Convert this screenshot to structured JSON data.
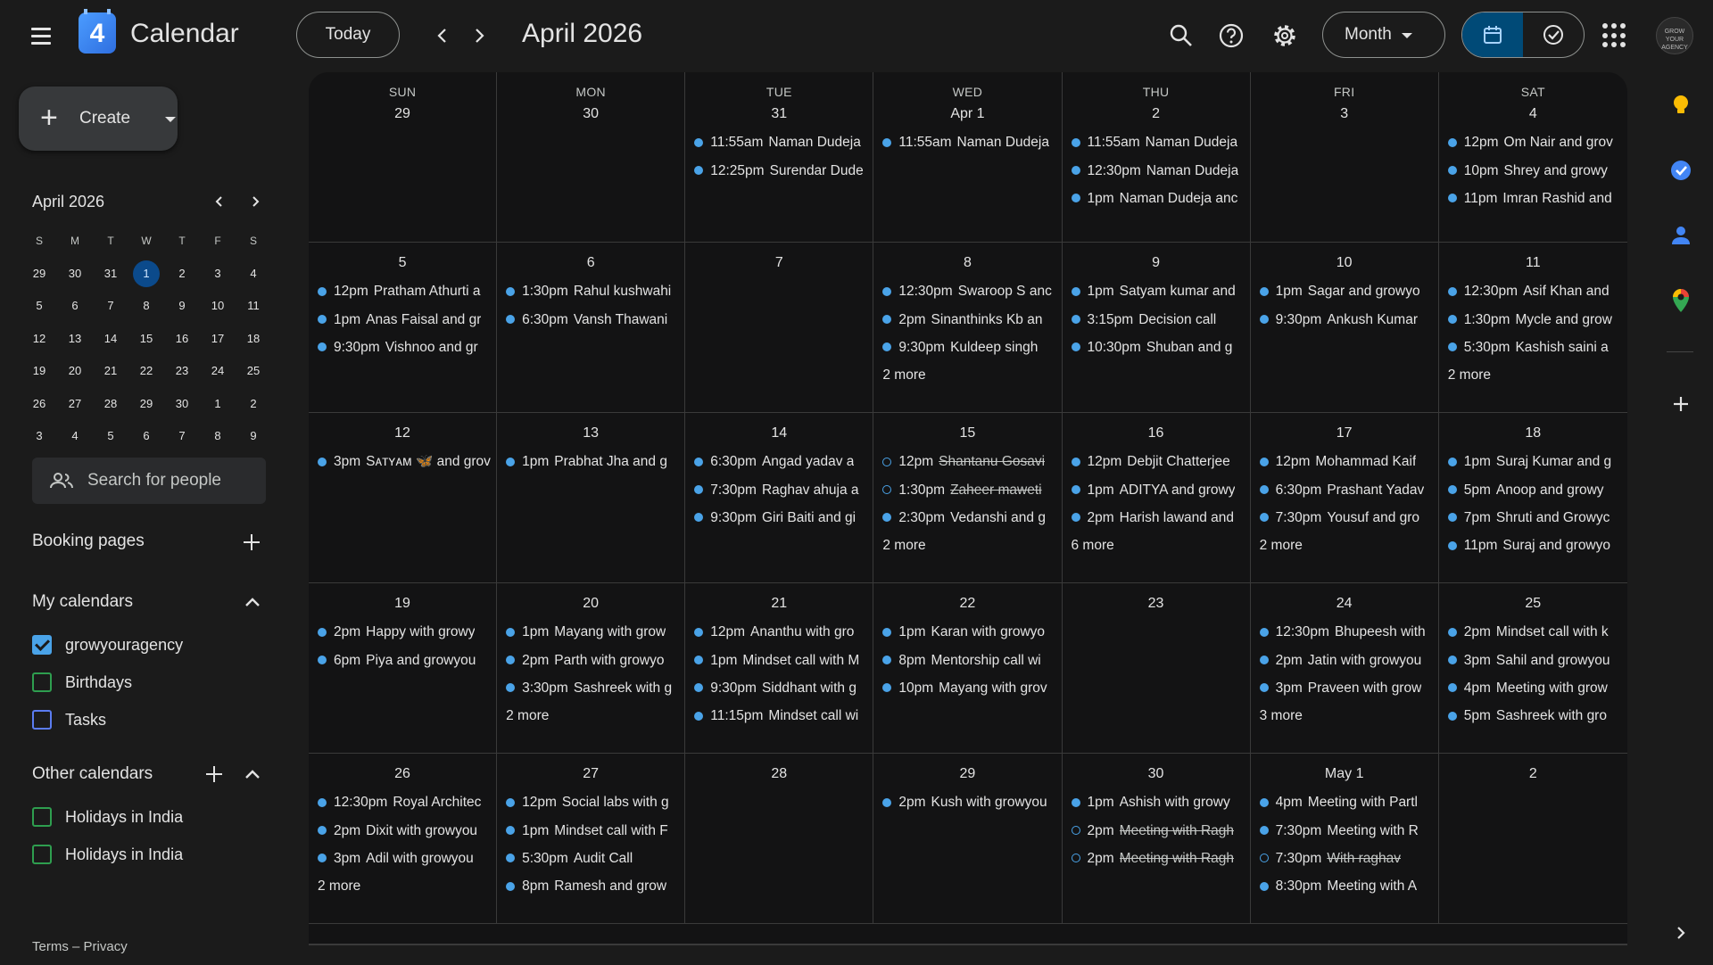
{
  "header": {
    "app_title": "Calendar",
    "logo_number": "4",
    "today_label": "Today",
    "period_title": "April 2026",
    "view_label": "Month",
    "prev_icon": "chevron-left-icon",
    "next_icon": "chevron-right-icon",
    "avatar_text": "GROW YOUR AGENCY"
  },
  "sidebar": {
    "create_label": "Create",
    "mini_calendar": {
      "title": "April 2026",
      "weekdays": [
        "S",
        "M",
        "T",
        "W",
        "T",
        "F",
        "S"
      ],
      "days": [
        [
          "29",
          "30",
          "31",
          "1",
          "2",
          "3",
          "4"
        ],
        [
          "5",
          "6",
          "7",
          "8",
          "9",
          "10",
          "11"
        ],
        [
          "12",
          "13",
          "14",
          "15",
          "16",
          "17",
          "18"
        ],
        [
          "19",
          "20",
          "21",
          "22",
          "23",
          "24",
          "25"
        ],
        [
          "26",
          "27",
          "28",
          "29",
          "30",
          "1",
          "2"
        ],
        [
          "3",
          "4",
          "5",
          "6",
          "7",
          "8",
          "9"
        ]
      ],
      "today": "1"
    },
    "search_placeholder": "Search for people",
    "booking_pages_title": "Booking pages",
    "my_calendars_title": "My calendars",
    "my_calendars": [
      {
        "name": "growyouragency",
        "checked": true,
        "color": "#4aa3e8"
      },
      {
        "name": "Birthdays",
        "checked": false,
        "color": "#2e9e4f"
      },
      {
        "name": "Tasks",
        "checked": false,
        "color": "#5b7cf0"
      }
    ],
    "other_calendars_title": "Other calendars",
    "other_calendars": [
      {
        "name": "Holidays in India",
        "checked": false,
        "color": "#2e9e4f"
      },
      {
        "name": "Holidays in India",
        "checked": false,
        "color": "#2e9e4f"
      }
    ],
    "footer_terms": "Terms",
    "footer_sep": " – ",
    "footer_privacy": "Privacy"
  },
  "colors": {
    "accent": "#4aa3e8",
    "background": "#1b1b1b",
    "grid_background": "#131314",
    "today_circle": "#0b4a8b"
  },
  "month_grid": {
    "weekday_labels": [
      "SUN",
      "MON",
      "TUE",
      "WED",
      "THU",
      "FRI",
      "SAT"
    ],
    "weeks": [
      [
        {
          "date": "29",
          "events": [],
          "more": ""
        },
        {
          "date": "30",
          "events": [],
          "more": ""
        },
        {
          "date": "31",
          "events": [
            {
              "time": "11:55am",
              "title": "Naman Dudeja",
              "declined": false
            },
            {
              "time": "12:25pm",
              "title": "Surendar Dude",
              "declined": false
            }
          ],
          "more": ""
        },
        {
          "date": "Apr 1",
          "events": [
            {
              "time": "11:55am",
              "title": "Naman Dudeja",
              "declined": false
            }
          ],
          "more": ""
        },
        {
          "date": "2",
          "events": [
            {
              "time": "11:55am",
              "title": "Naman Dudeja",
              "declined": false
            },
            {
              "time": "12:30pm",
              "title": "Naman Dudeja",
              "declined": false
            },
            {
              "time": "1pm",
              "title": "Naman Dudeja anc",
              "declined": false
            }
          ],
          "more": ""
        },
        {
          "date": "3",
          "events": [],
          "more": ""
        },
        {
          "date": "4",
          "events": [
            {
              "time": "12pm",
              "title": "Om Nair and grov",
              "declined": false
            },
            {
              "time": "10pm",
              "title": "Shrey and growy",
              "declined": false
            },
            {
              "time": "11pm",
              "title": "Imran Rashid and",
              "declined": false
            }
          ],
          "more": ""
        }
      ],
      [
        {
          "date": "5",
          "events": [
            {
              "time": "12pm",
              "title": "Pratham Athurti a",
              "declined": false
            },
            {
              "time": "1pm",
              "title": "Anas Faisal and gr",
              "declined": false
            },
            {
              "time": "9:30pm",
              "title": "Vishnoo and gr",
              "declined": false
            }
          ],
          "more": ""
        },
        {
          "date": "6",
          "events": [
            {
              "time": "1:30pm",
              "title": "Rahul kushwahi",
              "declined": false
            },
            {
              "time": "6:30pm",
              "title": "Vansh Thawani",
              "declined": false
            }
          ],
          "more": ""
        },
        {
          "date": "7",
          "events": [],
          "more": ""
        },
        {
          "date": "8",
          "events": [
            {
              "time": "12:30pm",
              "title": "Swaroop S anc",
              "declined": false
            },
            {
              "time": "2pm",
              "title": "Sinanthinks Kb an",
              "declined": false
            },
            {
              "time": "9:30pm",
              "title": "Kuldeep singh",
              "declined": false
            }
          ],
          "more": "2 more"
        },
        {
          "date": "9",
          "events": [
            {
              "time": "1pm",
              "title": "Satyam kumar and",
              "declined": false
            },
            {
              "time": "3:15pm",
              "title": "Decision call",
              "declined": false
            },
            {
              "time": "10:30pm",
              "title": "Shuban and g",
              "declined": false
            }
          ],
          "more": ""
        },
        {
          "date": "10",
          "events": [
            {
              "time": "1pm",
              "title": "Sagar and growyo",
              "declined": false
            },
            {
              "time": "9:30pm",
              "title": "Ankush Kumar",
              "declined": false
            }
          ],
          "more": ""
        },
        {
          "date": "11",
          "events": [
            {
              "time": "12:30pm",
              "title": "Asif Khan and",
              "declined": false
            },
            {
              "time": "1:30pm",
              "title": "Mycle and grow",
              "declined": false
            },
            {
              "time": "5:30pm",
              "title": "Kashish saini a",
              "declined": false
            }
          ],
          "more": "2 more"
        }
      ],
      [
        {
          "date": "12",
          "events": [
            {
              "time": "3pm",
              "title": "Sᴀᴛʏᴀᴍ 🦋 and grov",
              "declined": false
            }
          ],
          "more": ""
        },
        {
          "date": "13",
          "events": [
            {
              "time": "1pm",
              "title": "Prabhat Jha and g",
              "declined": false
            }
          ],
          "more": ""
        },
        {
          "date": "14",
          "events": [
            {
              "time": "6:30pm",
              "title": "Angad yadav a",
              "declined": false
            },
            {
              "time": "7:30pm",
              "title": "Raghav ahuja a",
              "declined": false
            },
            {
              "time": "9:30pm",
              "title": "Giri Baiti and gi",
              "declined": false
            }
          ],
          "more": ""
        },
        {
          "date": "15",
          "events": [
            {
              "time": "12pm",
              "title": "Shantanu Gosavi",
              "declined": true
            },
            {
              "time": "1:30pm",
              "title": "Zaheer maweti",
              "declined": true
            },
            {
              "time": "2:30pm",
              "title": "Vedanshi and g",
              "declined": false
            }
          ],
          "more": "2 more"
        },
        {
          "date": "16",
          "events": [
            {
              "time": "12pm",
              "title": "Debjit Chatterjee",
              "declined": false
            },
            {
              "time": "1pm",
              "title": "ADITYA and growy",
              "declined": false
            },
            {
              "time": "2pm",
              "title": "Harish lawand and",
              "declined": false
            }
          ],
          "more": "6 more"
        },
        {
          "date": "17",
          "events": [
            {
              "time": "12pm",
              "title": "Mohammad Kaif",
              "declined": false
            },
            {
              "time": "6:30pm",
              "title": "Prashant Yadav",
              "declined": false
            },
            {
              "time": "7:30pm",
              "title": "Yousuf and gro",
              "declined": false
            }
          ],
          "more": "2 more"
        },
        {
          "date": "18",
          "events": [
            {
              "time": "1pm",
              "title": "Suraj Kumar and g",
              "declined": false
            },
            {
              "time": "5pm",
              "title": "Anoop and growy",
              "declined": false
            },
            {
              "time": "7pm",
              "title": "Shruti and Growyc",
              "declined": false
            },
            {
              "time": "11pm",
              "title": "Suraj and growyo",
              "declined": false
            }
          ],
          "more": ""
        }
      ],
      [
        {
          "date": "19",
          "events": [
            {
              "time": "2pm",
              "title": "Happy with growy",
              "declined": false
            },
            {
              "time": "6pm",
              "title": "Piya and growyou",
              "declined": false
            }
          ],
          "more": ""
        },
        {
          "date": "20",
          "events": [
            {
              "time": "1pm",
              "title": "Mayang with grow",
              "declined": false
            },
            {
              "time": "2pm",
              "title": "Parth with growyo",
              "declined": false
            },
            {
              "time": "3:30pm",
              "title": "Sashreek with g",
              "declined": false
            }
          ],
          "more": "2 more"
        },
        {
          "date": "21",
          "events": [
            {
              "time": "12pm",
              "title": "Ananthu with gro",
              "declined": false
            },
            {
              "time": "1pm",
              "title": "Mindset call with M",
              "declined": false
            },
            {
              "time": "9:30pm",
              "title": "Siddhant with g",
              "declined": false
            },
            {
              "time": "11:15pm",
              "title": "Mindset call wi",
              "declined": false
            }
          ],
          "more": ""
        },
        {
          "date": "22",
          "events": [
            {
              "time": "1pm",
              "title": "Karan with growyo",
              "declined": false
            },
            {
              "time": "8pm",
              "title": "Mentorship call wi",
              "declined": false
            },
            {
              "time": "10pm",
              "title": "Mayang with grov",
              "declined": false
            }
          ],
          "more": ""
        },
        {
          "date": "23",
          "events": [],
          "more": ""
        },
        {
          "date": "24",
          "events": [
            {
              "time": "12:30pm",
              "title": "Bhupeesh with",
              "declined": false
            },
            {
              "time": "2pm",
              "title": "Jatin with growyou",
              "declined": false
            },
            {
              "time": "3pm",
              "title": "Praveen with grow",
              "declined": false
            }
          ],
          "more": "3 more"
        },
        {
          "date": "25",
          "events": [
            {
              "time": "2pm",
              "title": "Mindset call with k",
              "declined": false
            },
            {
              "time": "3pm",
              "title": "Sahil and growyou",
              "declined": false
            },
            {
              "time": "4pm",
              "title": "Meeting with grow",
              "declined": false
            },
            {
              "time": "5pm",
              "title": "Sashreek with gro",
              "declined": false
            }
          ],
          "more": ""
        }
      ],
      [
        {
          "date": "26",
          "events": [
            {
              "time": "12:30pm",
              "title": "Royal Architec",
              "declined": false
            },
            {
              "time": "2pm",
              "title": "Dixit with growyou",
              "declined": false
            },
            {
              "time": "3pm",
              "title": "Adil with growyou",
              "declined": false
            }
          ],
          "more": "2 more"
        },
        {
          "date": "27",
          "events": [
            {
              "time": "12pm",
              "title": "Social labs with g",
              "declined": false
            },
            {
              "time": "1pm",
              "title": "Mindset call with F",
              "declined": false
            },
            {
              "time": "5:30pm",
              "title": "Audit Call",
              "declined": false
            },
            {
              "time": "8pm",
              "title": "Ramesh and grow",
              "declined": false
            }
          ],
          "more": ""
        },
        {
          "date": "28",
          "events": [],
          "more": ""
        },
        {
          "date": "29",
          "events": [
            {
              "time": "2pm",
              "title": "Kush with growyou",
              "declined": false
            }
          ],
          "more": ""
        },
        {
          "date": "30",
          "events": [
            {
              "time": "1pm",
              "title": "Ashish with growy",
              "declined": false
            },
            {
              "time": "2pm",
              "title": "Meeting with Ragh",
              "declined": true
            },
            {
              "time": "2pm",
              "title": "Meeting with Ragh",
              "declined": true
            }
          ],
          "more": ""
        },
        {
          "date": "May 1",
          "events": [
            {
              "time": "4pm",
              "title": "Meeting with Partl",
              "declined": false
            },
            {
              "time": "7:30pm",
              "title": "Meeting with R",
              "declined": false
            },
            {
              "time": "7:30pm",
              "title": "With raghav",
              "declined": true
            },
            {
              "time": "8:30pm",
              "title": "Meeting with A",
              "declined": false
            }
          ],
          "more": ""
        },
        {
          "date": "2",
          "events": [],
          "more": ""
        }
      ]
    ]
  },
  "right_rail": {
    "icons": [
      "keep-icon",
      "tasks-icon",
      "contacts-icon",
      "maps-icon",
      "add-icon",
      "chevron-right-icon"
    ]
  }
}
